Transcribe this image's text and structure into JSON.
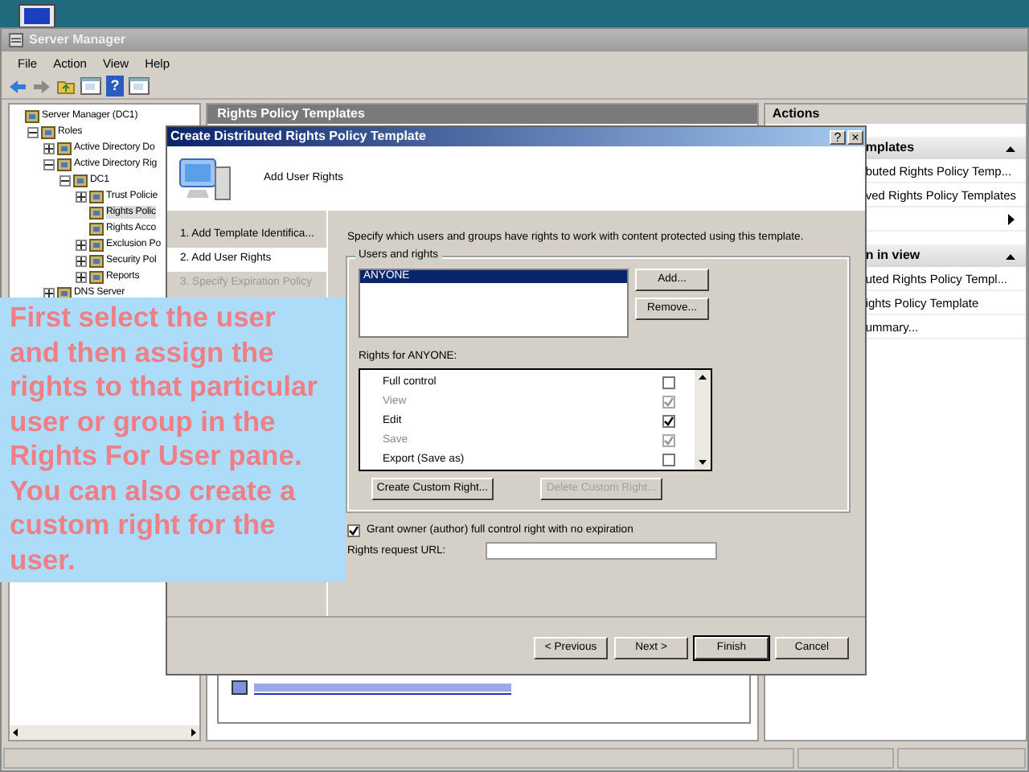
{
  "server_manager": {
    "title": "Server Manager",
    "menu": [
      "File",
      "Action",
      "View",
      "Help"
    ],
    "toolbar": [
      {
        "kind": "back"
      },
      {
        "kind": "forward"
      },
      {
        "kind": "up"
      },
      {
        "kind": "pane"
      },
      {
        "kind": "help",
        "label": "?"
      },
      {
        "kind": "pane"
      }
    ],
    "tree": [
      {
        "label": "Server Manager (DC1)",
        "selected": false,
        "children": [
          {
            "label": "Roles",
            "expanded": true,
            "selected": false,
            "children": [
              {
                "label": "Active Directory Do",
                "expanded": false,
                "selected": false
              },
              {
                "label": "Active Directory Rig",
                "expanded": true,
                "selected": false,
                "children": [
                  {
                    "label": "DC1",
                    "expanded": true,
                    "selected": false,
                    "children": [
                      {
                        "label": "Trust Policie",
                        "expanded": false,
                        "selected": false
                      },
                      {
                        "label": "Rights Polic",
                        "selected": true
                      },
                      {
                        "label": "Rights Acco",
                        "selected": false
                      },
                      {
                        "label": "Exclusion Po",
                        "expanded": false,
                        "selected": false
                      },
                      {
                        "label": "Security Pol",
                        "expanded": false,
                        "selected": false
                      },
                      {
                        "label": "Reports",
                        "expanded": false,
                        "selected": false
                      }
                    ]
                  }
                ]
              },
              {
                "label": "DNS Server",
                "expanded": false,
                "selected": false
              }
            ]
          }
        ]
      }
    ],
    "center": {
      "title": "Rights Policy Templates"
    },
    "actions": {
      "title": "Actions",
      "sections": [
        {
          "title": "mplates",
          "items": [
            {
              "kind": "link",
              "label": "buted Rights Policy Temp..."
            },
            {
              "kind": "link",
              "label": "ved Rights Policy Templates"
            },
            {
              "kind": "submenu"
            }
          ]
        },
        {
          "title": "n in view",
          "items": [
            {
              "kind": "link",
              "label": "uted Rights Policy Templ..."
            },
            {
              "kind": "link",
              "label": "ights Policy Template"
            },
            {
              "kind": "link",
              "label": "ummary..."
            }
          ]
        }
      ]
    }
  },
  "dialog": {
    "title": "Create Distributed Rights Policy Template",
    "title_buttons": [
      "?",
      "×"
    ],
    "heading": "Add User Rights",
    "steps": [
      {
        "label": "1. Add Template Identifica...",
        "selected": false,
        "disabled": false
      },
      {
        "label": "2. Add User Rights",
        "selected": true,
        "disabled": false
      },
      {
        "label": "3. Specify Expiration Policy",
        "selected": false,
        "disabled": true
      }
    ],
    "instruction": "Specify which users and groups have rights to work with content protected using this template.",
    "users_group": {
      "legend": "Users and rights",
      "users": [
        {
          "label": "ANYONE",
          "selected": true
        }
      ],
      "buttons": [
        "Add...",
        "Remove..."
      ]
    },
    "rights_label": "Rights for ANYONE:",
    "rights": [
      {
        "label": "Full control",
        "checked": false,
        "disabled": false
      },
      {
        "label": "View",
        "checked": true,
        "disabled": true
      },
      {
        "label": "Edit",
        "checked": true,
        "disabled": false
      },
      {
        "label": "Save",
        "checked": true,
        "disabled": true
      },
      {
        "label": "Export (Save as)",
        "checked": false,
        "disabled": false
      }
    ],
    "custom_buttons": [
      {
        "label": "Create Custom Right...",
        "disabled": false
      },
      {
        "label": "Delete Custom Right...",
        "disabled": true
      }
    ],
    "grant_owner": {
      "label": "Grant owner (author) full control right with no expiration",
      "checked": true
    },
    "url_label": "Rights request URL:",
    "nav_buttons": [
      {
        "label": "< Previous",
        "default": false
      },
      {
        "label": "Next >",
        "default": false
      },
      {
        "label": "Finish",
        "default": true
      },
      {
        "label": "Cancel",
        "default": false
      }
    ]
  },
  "callout": {
    "text": "First select the user and then assign the rights to that particular user or group in the Rights For User pane. You can also create a custom right for the user."
  }
}
